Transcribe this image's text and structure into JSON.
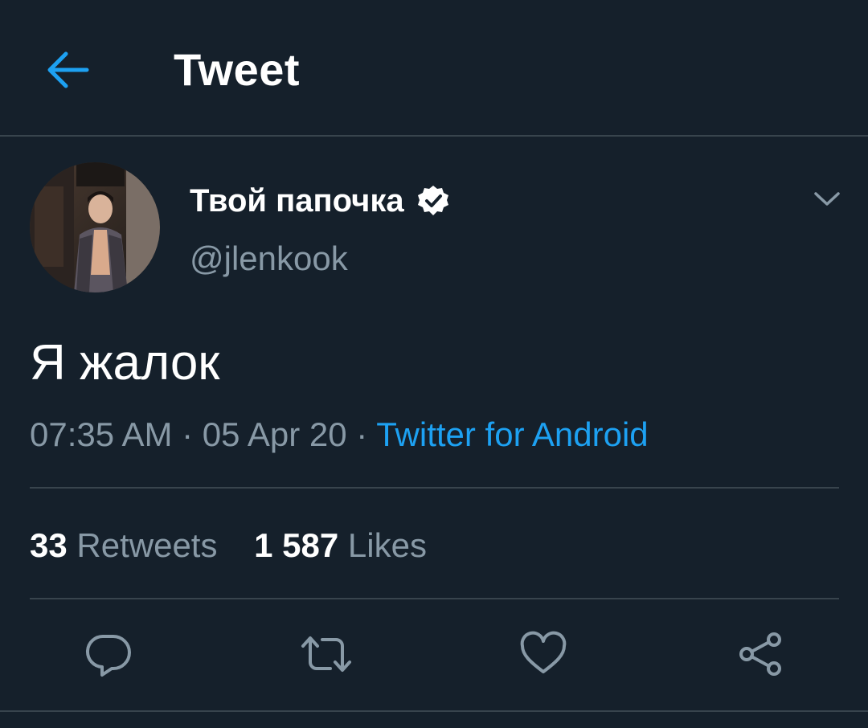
{
  "header": {
    "title": "Tweet",
    "back_icon": "arrow-left-icon"
  },
  "author": {
    "display_name": "Твой папочка",
    "handle": "@jlenkook",
    "verified": true
  },
  "tweet": {
    "text": "Я жалок",
    "time": "07:35 AM",
    "date": "05 Apr 20",
    "separator": " · ",
    "source": "Twitter for Android"
  },
  "stats": {
    "retweets_count": "33",
    "retweets_label": "Retweets",
    "likes_count": "1 587",
    "likes_label": "Likes"
  },
  "actions": [
    {
      "name": "reply",
      "icon": "reply-icon"
    },
    {
      "name": "retweet",
      "icon": "retweet-icon"
    },
    {
      "name": "like",
      "icon": "heart-icon"
    },
    {
      "name": "share",
      "icon": "share-icon"
    }
  ],
  "colors": {
    "background": "#15202b",
    "accent": "#1da1f2",
    "secondary_text": "#8899a6",
    "divider": "#38444d"
  }
}
